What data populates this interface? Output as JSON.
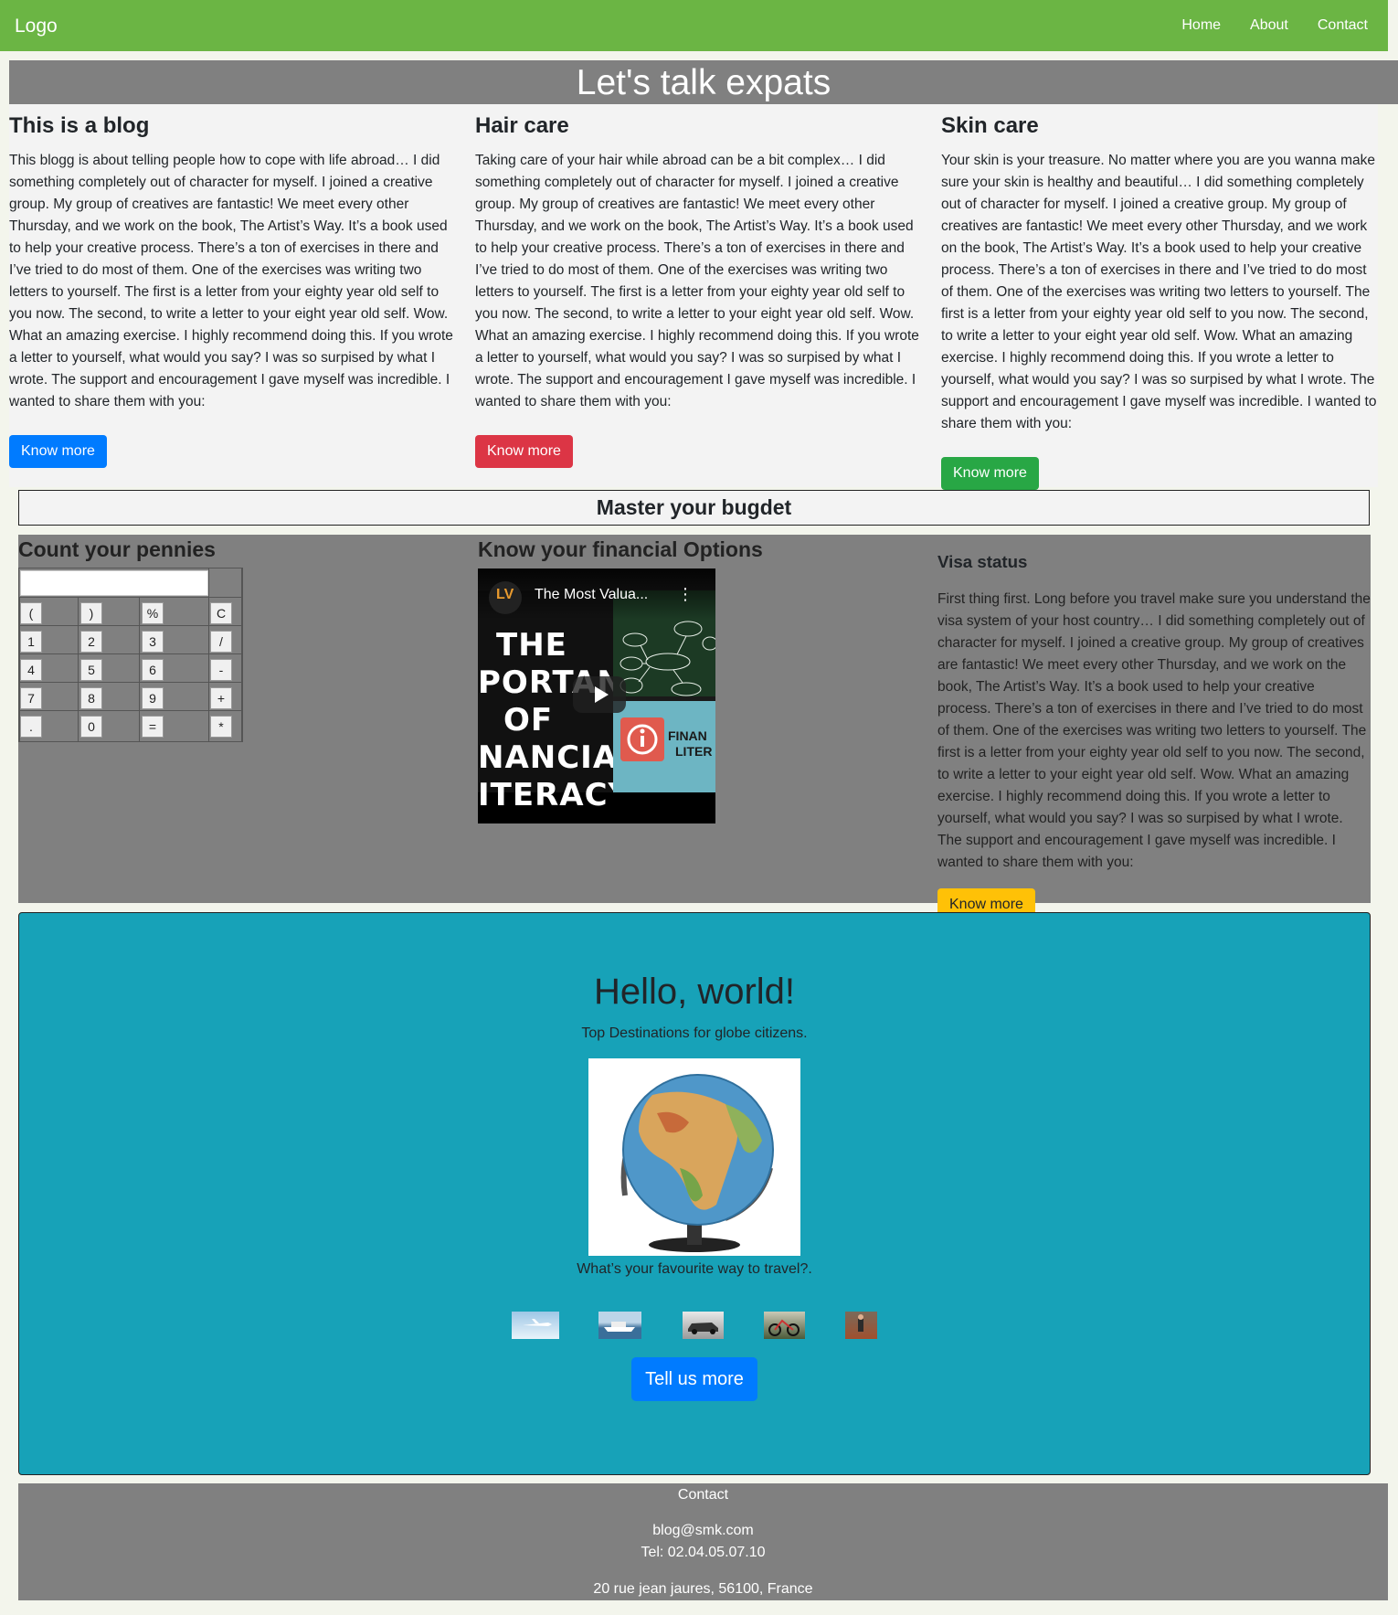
{
  "navbar": {
    "logo": "Logo",
    "links": [
      "Home",
      "About",
      "Contact"
    ]
  },
  "hero": {
    "title": "Let's talk expats"
  },
  "blog": [
    {
      "title": "This is a blog",
      "text": "This blogg is about telling people how to cope with life abroad… I did something completely out of character for myself. I joined a creative group. My group of creatives are fantastic! We meet every other Thursday, and we work on the book, The Artist’s Way. It’s a book used to help your creative process. There’s a ton of exercises in there and I’ve tried to do most of them. One of the exercises was writing two letters to yourself. The first is a letter from your eighty year old self to you now. The second, to write a letter to your eight year old self. Wow. What an amazing exercise. I highly recommend doing this. If you wrote a letter to yourself, what would you say? I was so surpised by what I wrote. The support and encouragement I gave myself was incredible. I wanted to share them with you:",
      "button": "Know more"
    },
    {
      "title": "Hair care",
      "text": "Taking care of your hair while abroad can be a bit complex… I did something completely out of character for myself. I joined a creative group. My group of creatives are fantastic! We meet every other Thursday, and we work on the book, The Artist’s Way. It’s a book used to help your creative process. There’s a ton of exercises in there and I’ve tried to do most of them. One of the exercises was writing two letters to yourself. The first is a letter from your eighty year old self to you now. The second, to write a letter to your eight year old self. Wow. What an amazing exercise. I highly recommend doing this. If you wrote a letter to yourself, what would you say? I was so surpised by what I wrote. The support and encouragement I gave myself was incredible. I wanted to share them with you:",
      "button": "Know more"
    },
    {
      "title": "Skin care",
      "text": "Your skin is your treasure. No matter where you are you wanna make sure your skin is healthy and beautiful… I did something completely out of character for myself. I joined a creative group. My group of creatives are fantastic! We meet every other Thursday, and we work on the book, The Artist’s Way. It’s a book used to help your creative process. There’s a ton of exercises in there and I’ve tried to do most of them. One of the exercises was writing two letters to yourself. The first is a letter from your eighty year old self to you now. The second, to write a letter to your eight year old self. Wow. What an amazing exercise. I highly recommend doing this. If you wrote a letter to yourself, what would you say? I was so surpised by what I wrote. The support and encouragement I gave myself was incredible. I wanted to share them with you:",
      "button": "Know more"
    }
  ],
  "budget": {
    "heading": "Master your bugdet",
    "calc_title": "Count your pennies",
    "calc_keys": [
      "(",
      ")",
      "%",
      "C",
      "1",
      "2",
      "3",
      "/",
      "4",
      "5",
      "6",
      "-",
      "7",
      "8",
      "9",
      "+",
      ".",
      "0",
      "=",
      "*"
    ],
    "video_section_title": "Know your financial Options",
    "video": {
      "title": "The Most Valua...",
      "channel_badge": "LV",
      "thumbnail_text": [
        "THE",
        "PORTANCE",
        "OF",
        "NANCIAL",
        "ITERACY"
      ],
      "info_text": [
        "FINAN",
        "LITER"
      ]
    },
    "visa_title": "Visa status",
    "visa_text": "First thing first. Long before you travel make sure you understand the visa system of your host country… I did something completely out of character for myself. I joined a creative group. My group of creatives are fantastic! We meet every other Thursday, and we work on the book, The Artist’s Way. It’s a book used to help your creative process. There’s a ton of exercises in there and I’ve tried to do most of them. One of the exercises was writing two letters to yourself. The first is a letter from your eighty year old self to you now. The second, to write a letter to your eight year old self. Wow. What an amazing exercise. I highly recommend doing this. If you wrote a letter to yourself, what would you say? I was so surpised by what I wrote. The support and encouragement I gave myself was incredible. I wanted to share them with you:",
    "visa_button": "Know more"
  },
  "jumbotron": {
    "title": "Hello, world!",
    "subtitle": "Top Destinations for globe citizens.",
    "question": "What’s your favourite way to travel?.",
    "button": "Tell us more",
    "thumbnails": [
      "plane-image",
      "ship-image",
      "car-image",
      "bike-image",
      "hiking-image"
    ]
  },
  "footer": {
    "heading": "Contact",
    "email": "blog@smk.com",
    "phone": "Tel: 02.04.05.07.10",
    "address": "20 rue jean jaures, 56100, France"
  },
  "colors": {
    "navbar": "#6bb544",
    "panel_gray": "#808080",
    "jumbotron": "#17a2b8",
    "primary": "#007bff",
    "danger": "#dc3545",
    "success": "#28a745",
    "warning": "#ffc107"
  }
}
